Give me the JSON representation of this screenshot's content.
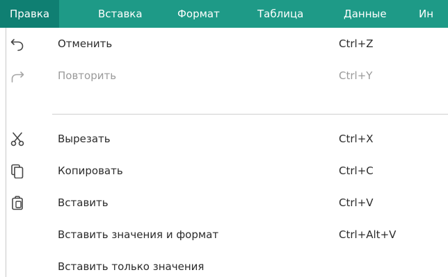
{
  "menubar": {
    "items": [
      {
        "label": "Правка"
      },
      {
        "label": "Вставка"
      },
      {
        "label": "Формат"
      },
      {
        "label": "Таблица"
      },
      {
        "label": "Данные"
      },
      {
        "label": "Ин"
      }
    ]
  },
  "dropdown": {
    "items": [
      {
        "label": "Отменить",
        "shortcut": "Ctrl+Z",
        "icon": "undo-icon",
        "enabled": true
      },
      {
        "label": "Повторить",
        "shortcut": "Ctrl+Y",
        "icon": "redo-icon",
        "enabled": false
      },
      {
        "label": "Вырезать",
        "shortcut": "Ctrl+X",
        "icon": "cut-icon",
        "enabled": true
      },
      {
        "label": "Копировать",
        "shortcut": "Ctrl+C",
        "icon": "copy-icon",
        "enabled": true
      },
      {
        "label": "Вставить",
        "shortcut": "Ctrl+V",
        "icon": "paste-icon",
        "enabled": true
      },
      {
        "label": "Вставить значения и формат",
        "shortcut": "Ctrl+Alt+V",
        "icon": "",
        "enabled": true
      },
      {
        "label": "Вставить только значения",
        "shortcut": "",
        "icon": "",
        "enabled": true
      }
    ]
  },
  "colors": {
    "menubar": "#1e9a87",
    "menubar_active": "#0f7f72",
    "text": "#2b2b2b",
    "disabled_text": "#9a9a9a"
  }
}
